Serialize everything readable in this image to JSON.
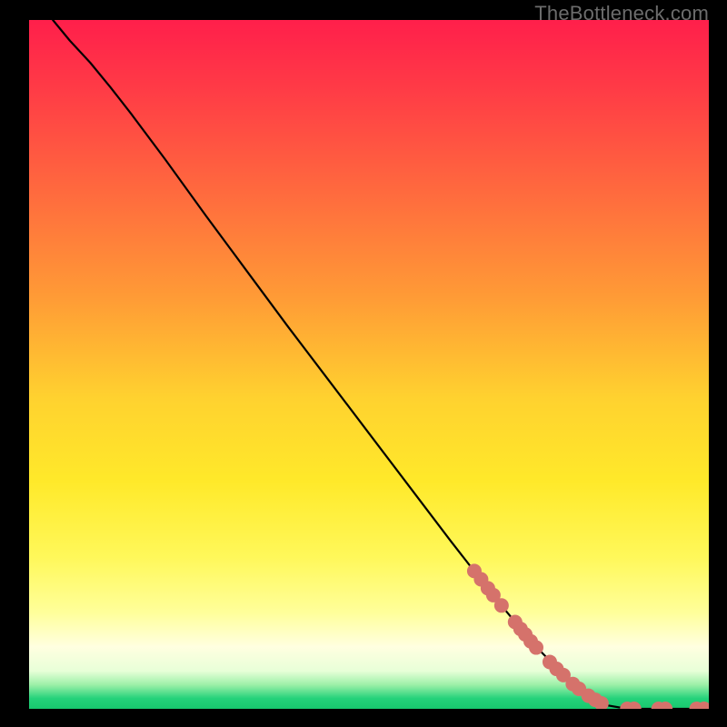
{
  "watermark": "TheBottleneck.com",
  "chart_data": {
    "type": "line",
    "title": "",
    "xlabel": "",
    "ylabel": "",
    "xlim": [
      0,
      100
    ],
    "ylim": [
      0,
      100
    ],
    "grid": false,
    "gradient_stops": [
      {
        "offset": 0.0,
        "color": "#ff1f4b"
      },
      {
        "offset": 0.1,
        "color": "#ff3b46"
      },
      {
        "offset": 0.25,
        "color": "#ff6a3e"
      },
      {
        "offset": 0.4,
        "color": "#ff9a36"
      },
      {
        "offset": 0.55,
        "color": "#ffd22f"
      },
      {
        "offset": 0.67,
        "color": "#ffe92a"
      },
      {
        "offset": 0.78,
        "color": "#fff85a"
      },
      {
        "offset": 0.86,
        "color": "#ffff9a"
      },
      {
        "offset": 0.91,
        "color": "#ffffe0"
      },
      {
        "offset": 0.945,
        "color": "#e8ffd8"
      },
      {
        "offset": 0.965,
        "color": "#9df0a8"
      },
      {
        "offset": 0.985,
        "color": "#24d27a"
      },
      {
        "offset": 1.0,
        "color": "#18c86e"
      }
    ],
    "curve_points": [
      {
        "x": 3.5,
        "y": 100.0
      },
      {
        "x": 6.0,
        "y": 97.0
      },
      {
        "x": 9.0,
        "y": 93.8
      },
      {
        "x": 12.0,
        "y": 90.2
      },
      {
        "x": 15.0,
        "y": 86.4
      },
      {
        "x": 20.0,
        "y": 79.8
      },
      {
        "x": 26.0,
        "y": 71.6
      },
      {
        "x": 32.0,
        "y": 63.6
      },
      {
        "x": 38.0,
        "y": 55.6
      },
      {
        "x": 44.0,
        "y": 47.8
      },
      {
        "x": 50.0,
        "y": 40.0
      },
      {
        "x": 56.0,
        "y": 32.2
      },
      {
        "x": 62.0,
        "y": 24.4
      },
      {
        "x": 68.0,
        "y": 16.8
      },
      {
        "x": 74.0,
        "y": 9.6
      },
      {
        "x": 80.0,
        "y": 3.6
      },
      {
        "x": 84.5,
        "y": 0.6
      },
      {
        "x": 88.0,
        "y": 0.0
      },
      {
        "x": 100.0,
        "y": 0.0
      }
    ],
    "markers": [
      {
        "x": 65.5,
        "y": 20.0
      },
      {
        "x": 66.5,
        "y": 18.8
      },
      {
        "x": 67.5,
        "y": 17.5
      },
      {
        "x": 68.3,
        "y": 16.5
      },
      {
        "x": 69.5,
        "y": 15.0
      },
      {
        "x": 71.5,
        "y": 12.6
      },
      {
        "x": 72.3,
        "y": 11.6
      },
      {
        "x": 73.0,
        "y": 10.8
      },
      {
        "x": 73.8,
        "y": 9.8
      },
      {
        "x": 74.6,
        "y": 8.9
      },
      {
        "x": 76.6,
        "y": 6.8
      },
      {
        "x": 77.6,
        "y": 5.8
      },
      {
        "x": 78.6,
        "y": 4.9
      },
      {
        "x": 80.0,
        "y": 3.6
      },
      {
        "x": 80.9,
        "y": 2.9
      },
      {
        "x": 82.3,
        "y": 1.9
      },
      {
        "x": 83.3,
        "y": 1.3
      },
      {
        "x": 84.2,
        "y": 0.8
      },
      {
        "x": 88.0,
        "y": 0.0
      },
      {
        "x": 89.0,
        "y": 0.0
      },
      {
        "x": 92.6,
        "y": 0.0
      },
      {
        "x": 93.6,
        "y": 0.0
      },
      {
        "x": 98.2,
        "y": 0.0
      },
      {
        "x": 99.3,
        "y": 0.0
      }
    ],
    "marker_style": {
      "fill": "#d5726b",
      "r": 8
    }
  }
}
